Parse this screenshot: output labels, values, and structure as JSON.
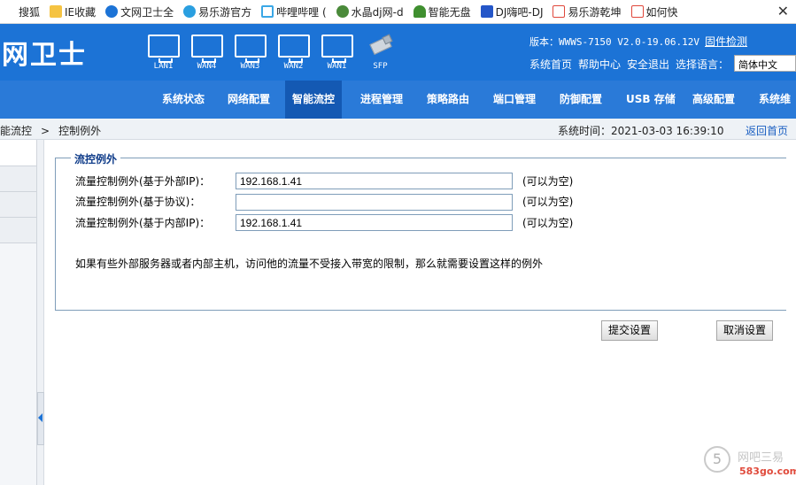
{
  "bookmarks": [
    {
      "label": "搜狐",
      "icon": "sohu-icon",
      "color": "#ffffff"
    },
    {
      "label": "IE收藏",
      "icon": "folder-icon",
      "color": "#f5c342"
    },
    {
      "label": "文网卫士全",
      "icon": "shield-icon",
      "color": "#1c73d6"
    },
    {
      "label": "易乐游官方",
      "icon": "globe-icon",
      "color": "#2a9fe0"
    },
    {
      "label": "哔哩哔哩 (",
      "icon": "bilibili-icon",
      "color": "#3aa7e6"
    },
    {
      "label": "水晶dj网-d",
      "icon": "crystal-icon",
      "color": "#4a8a3a"
    },
    {
      "label": "智能无盘",
      "icon": "tree-icon",
      "color": "#3f8f2f"
    },
    {
      "label": "DJ嗨吧-DJ",
      "icon": "dj-icon",
      "color": "#2456c8"
    },
    {
      "label": "易乐游乾坤",
      "icon": "583-icon",
      "color": "#e0473b"
    },
    {
      "label": "如何快",
      "icon": "583-icon",
      "color": "#e0473b"
    }
  ],
  "header": {
    "brand": "文网卫士",
    "ports": [
      {
        "label": "LAN1"
      },
      {
        "label": "WAN4"
      },
      {
        "label": "WAN3"
      },
      {
        "label": "WAN2"
      },
      {
        "label": "WAN1"
      }
    ],
    "sfp_label": "SFP",
    "version": "版本：WWWS-7150 V2.0-19.06.12V",
    "firmware_link": "固件检测",
    "links": [
      "系统首页",
      "帮助中心",
      "安全退出",
      "选择语言："
    ],
    "language": "简体中文"
  },
  "nav": [
    {
      "label": "系统状态",
      "active": false
    },
    {
      "label": "网络配置",
      "active": false
    },
    {
      "label": "智能流控",
      "active": true
    },
    {
      "label": "进程管理",
      "active": false
    },
    {
      "label": "策略路由",
      "active": false
    },
    {
      "label": "端口管理",
      "active": false
    },
    {
      "label": "防御配置",
      "active": false
    },
    {
      "label": "USB 存储",
      "active": false
    },
    {
      "label": "高级配置",
      "active": false
    },
    {
      "label": "系统维",
      "active": false
    }
  ],
  "breadcrumb": {
    "parent": "能流控",
    "separator": ">",
    "current": "控制例外",
    "system_time": "系统时间：2021-03-03 16:39:10",
    "back": "返回首页"
  },
  "form": {
    "legend": "流控例外",
    "rows": [
      {
        "label": "流量控制例外(基于外部IP)：",
        "value": "192.168.1.41",
        "hint": "(可以为空)"
      },
      {
        "label": "流量控制例外(基于协议)：",
        "value": "",
        "hint": "(可以为空)"
      },
      {
        "label": "流量控制例外(基于内部IP)：",
        "value": "192.168.1.41",
        "hint": "(可以为空)"
      }
    ],
    "note": "如果有些外部服务器或者内部主机，访问他的流量不受接入带宽的限制，那么就需要设置这样的例外"
  },
  "buttons": {
    "submit": "提交设置",
    "cancel": "取消设置"
  },
  "watermark": {
    "glyph": "5",
    "text1": "网吧三易",
    "text2": "583go.com"
  },
  "colors": {
    "header_blue": "#1c73d6",
    "nav_blue": "#2a7ad8",
    "active_nav": "#1459b3",
    "legend_text": "#103d8a",
    "border": "#7f9db9"
  }
}
